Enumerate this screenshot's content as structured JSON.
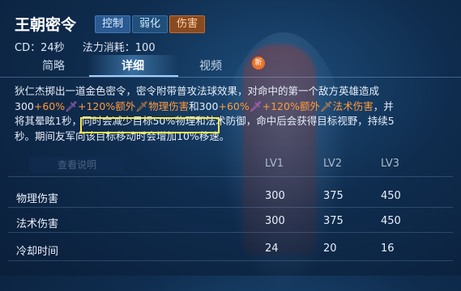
{
  "skill": {
    "name": "王朝密令",
    "tags": [
      "控制",
      "弱化",
      "伤害"
    ],
    "cd": "CD：24秒",
    "mana": "法力消耗：100"
  },
  "tabs": {
    "items": [
      "简略",
      "详细",
      "视频"
    ],
    "active": "详细",
    "new_badge": "新"
  },
  "description": {
    "seg1": "狄仁杰掷出一道金色密令，密令附带普攻法球效果，对命中的第一个敌方英雄造成300",
    "seg2": "+60%",
    "seg3": "+120%额外",
    "seg4": "物理伤害",
    "seg5": "和300",
    "seg6": "+60%",
    "seg7": "+120%额外",
    "seg8": "法术伤害",
    "seg9": "，并将其晕眩1秒，同时会",
    "seg10": "减少目标50%物理和法术防御",
    "seg11": "，命中后会获得目标视野，持续5秒。期间友军向该目标移动时会增加10%移速。"
  },
  "faded_button": "查看说明",
  "table": {
    "headers": [
      "LV1",
      "LV2",
      "LV3"
    ],
    "rows": [
      {
        "label": "物理伤害",
        "values": [
          "300",
          "375",
          "450"
        ]
      },
      {
        "label": "法术伤害",
        "values": [
          "300",
          "375",
          "450"
        ]
      },
      {
        "label": "冷却时间",
        "values": [
          "24",
          "20",
          "16"
        ]
      }
    ]
  },
  "colors": {
    "orange_text": "#ff9a3c",
    "pink_icon": "#e070e0",
    "highlight": "#ffe84a"
  }
}
